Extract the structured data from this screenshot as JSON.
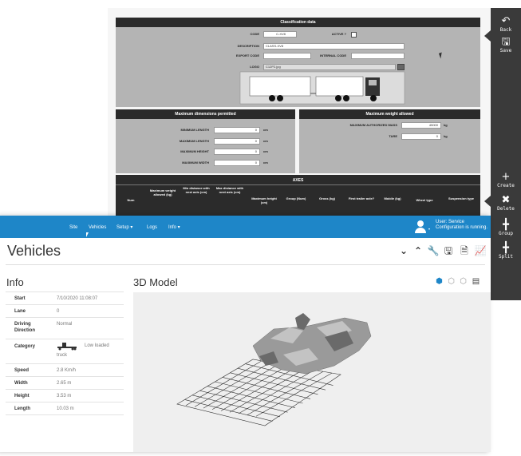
{
  "classification": {
    "header": "Classification data",
    "code_label": "CODE",
    "code_value": "C-XV8",
    "active_label": "ACTIVE ?",
    "description_label": "DESCRIPTION",
    "description_value": "CLASS-XV8",
    "export_code_label": "EXPORT CODE",
    "internal_code_label": "INTERNAL CODE",
    "logo_label": "LOGO",
    "logo_value": "C12P2.jpg"
  },
  "dimensions": {
    "header": "Maximum dimensions permitted",
    "rows": [
      {
        "label": "MINIMUM LENGTH",
        "value": "0",
        "unit": "cm"
      },
      {
        "label": "MAXIMUM LENGTH",
        "value": "0",
        "unit": "cm"
      },
      {
        "label": "MAXIMUM HEIGHT",
        "value": "0",
        "unit": "cm"
      },
      {
        "label": "MAXIMUM WIDTH",
        "value": "0",
        "unit": "cm"
      }
    ]
  },
  "weight": {
    "header": "Maximum weight allowed",
    "max_label": "MAXIMUM AUTHORIZED MASS",
    "max_value": "45000",
    "max_unit": "kg",
    "tare_label": "TARE",
    "tare_value": "0",
    "tare_unit": "kg"
  },
  "axes": {
    "header": "AXES",
    "columns": [
      "Num",
      "Maximum weight allowed (kg)",
      "Min distance with next axis (cm)",
      "Max distance with next axis (cm)",
      "Maximum height (cm)",
      "Group (Num)",
      "Gross (kg)",
      "First trailer axle?",
      "Mobile (kg)",
      "Wheel type",
      "Suspension type"
    ]
  },
  "right_toolbar": {
    "back": "Back",
    "save": "Save",
    "create": "Create",
    "delete": "Delete",
    "group": "Group",
    "split": "Split"
  },
  "nav": {
    "items": [
      "Site",
      "Vehicles",
      "Setup ▾",
      "Logs",
      "Info ▾"
    ],
    "user": "User: Service",
    "status": "Configuration is running."
  },
  "page_title": "Vehicles",
  "info": {
    "title": "Info",
    "rows": [
      {
        "label": "Start",
        "value": "7/10/2020 11:08:07"
      },
      {
        "label": "Lane",
        "value": "0"
      },
      {
        "label": "Driving",
        "label2": "Direction",
        "value": "Normal"
      },
      {
        "label": "Category",
        "value": "Low loaded",
        "value2": "truck"
      },
      {
        "label": "Speed",
        "value": "2.8 Km/h"
      },
      {
        "label": "Width",
        "value": "2.65 m"
      },
      {
        "label": "Height",
        "value": "3.53 m"
      },
      {
        "label": "Length",
        "value": "10.03 m"
      }
    ]
  },
  "model": {
    "title": "3D Model"
  },
  "colors": {
    "nav_blue": "#1e86c8",
    "model_icon_blue": "#1e86c8",
    "panel_gray": "#b4b4b4",
    "header_dark": "#2b2b2b"
  }
}
